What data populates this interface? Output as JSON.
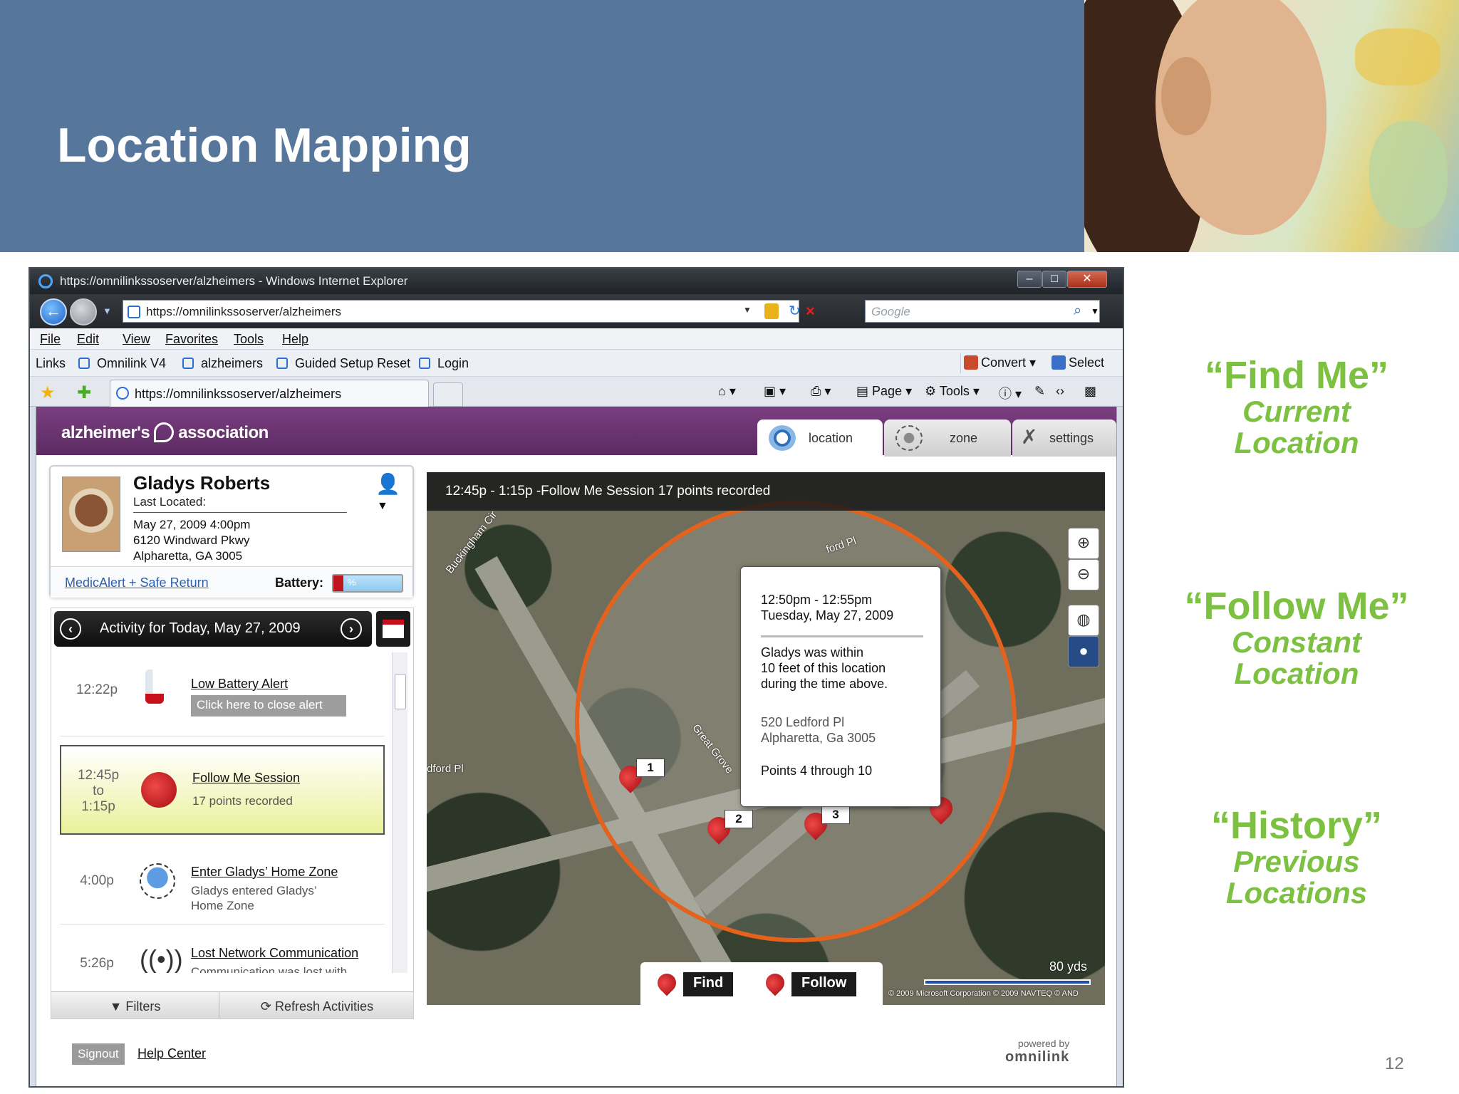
{
  "slide": {
    "title": "Location Mapping",
    "page_number": "12",
    "captions": [
      {
        "heading": "“Find Me”",
        "line1": "Current",
        "line2": "Location"
      },
      {
        "heading": "“Follow Me”",
        "line1": "Constant",
        "line2": "Location"
      },
      {
        "heading": "“History”",
        "line1": "Previous",
        "line2": "Locations"
      }
    ],
    "accent_color": "#7dc142",
    "header_color": "#56779b"
  },
  "browser": {
    "window_title": "https://omnilinkssoserver/alzheimers - Windows Internet Explorer",
    "address_url": "https://omnilinkssoserver/alzheimers",
    "search_placeholder": "Google",
    "menu": [
      "File",
      "Edit",
      "View",
      "Favorites",
      "Tools",
      "Help"
    ],
    "links_label": "Links",
    "links": [
      "Omnilink V4",
      "alzheimers",
      "Guided Setup Reset",
      "Login"
    ],
    "convert_label": "Convert",
    "select_label": "Select",
    "tab_title": "https://omnilinkssoserver/alzheimers",
    "commands": {
      "page": "Page",
      "tools": "Tools"
    }
  },
  "app": {
    "brand": {
      "left": "alzheimer's",
      "right": "association"
    },
    "tabs": {
      "location": "location",
      "zone": "zone",
      "settings": "settings"
    },
    "person": {
      "name": "Gladys Roberts",
      "last_located_label": "Last Located:",
      "date": "May 27, 2009 4:00pm",
      "address1": "6120 Windward Pkwy",
      "address2": "Alpharetta, GA 3005",
      "medic_link": "MedicAlert + Safe Return",
      "battery_label": "Battery:",
      "battery_text": "%",
      "battery_level": 0.15
    },
    "activity": {
      "title": "Activity for Today, May 27, 2009",
      "items": [
        {
          "time": "12:22p",
          "title": "Low Battery Alert",
          "button": "Click here to close alert"
        },
        {
          "time": "12:45p",
          "time_to": "to",
          "time_end": "1:15p",
          "title": "Follow Me Session",
          "desc": "17 points recorded"
        },
        {
          "time": "4:00p",
          "title": "Enter Gladys’ Home Zone",
          "desc1": "Gladys entered Gladys’",
          "desc2": "Home Zone"
        },
        {
          "time": "5:26p",
          "title": "Lost Network Communication",
          "desc": "Communication was lost with"
        }
      ],
      "filters_label": "Filters",
      "refresh_label": "Refresh Activities"
    },
    "footer": {
      "signout": "Signout",
      "help": "Help Center",
      "powered_by": "powered by",
      "omnilink": "omnilink"
    },
    "map": {
      "banner": "12:45p - 1:15p -Follow Me Session 17 points recorded",
      "streets": {
        "buckingham": "Buckingham Cir",
        "ford": "ford Pl",
        "great_grove": "Great Grove",
        "ledford": "dford Pl"
      },
      "popup": {
        "time": "12:50pm - 12:55pm",
        "day": "Tuesday, May 27, 2009",
        "msg1": "Gladys was within",
        "msg2": "10 feet of this location",
        "msg3": "during the time above.",
        "addr1": "520 Ledford Pl",
        "addr2": "Alpharetta, Ga 3005",
        "points": "Points 4 through 10"
      },
      "pins": [
        "1",
        "2",
        "3"
      ],
      "find_label": "Find",
      "follow_label": "Follow",
      "scale": "80 yds",
      "copyright": "© 2009 Microsoft Corporation   © 2009 NAVTEQ   © AND",
      "circle_color": "#e2621e"
    }
  }
}
